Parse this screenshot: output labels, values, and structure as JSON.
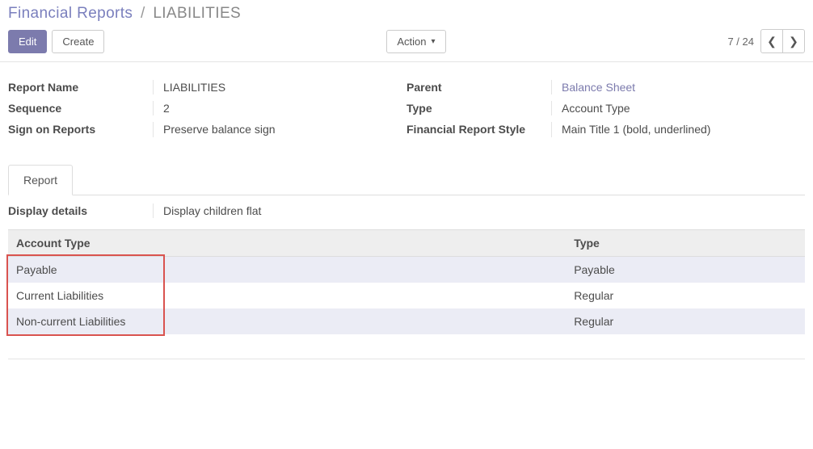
{
  "breadcrumb": {
    "root": "Financial Reports",
    "current": "LIABILITIES"
  },
  "toolbar": {
    "edit_label": "Edit",
    "create_label": "Create",
    "action_label": "Action"
  },
  "pager": {
    "position": "7 / 24"
  },
  "fields": {
    "report_name_label": "Report Name",
    "report_name_value": "LIABILITIES",
    "sequence_label": "Sequence",
    "sequence_value": "2",
    "sign_label": "Sign on Reports",
    "sign_value": "Preserve balance sign",
    "parent_label": "Parent",
    "parent_value": "Balance Sheet",
    "type_label": "Type",
    "type_value": "Account Type",
    "style_label": "Financial Report Style",
    "style_value": "Main Title 1 (bold, underlined)"
  },
  "tabs": {
    "report": "Report"
  },
  "details": {
    "display_label": "Display details",
    "display_value": "Display children flat"
  },
  "table": {
    "col_account_type": "Account Type",
    "col_type": "Type",
    "rows": [
      {
        "account_type": "Payable",
        "type": "Payable"
      },
      {
        "account_type": "Current Liabilities",
        "type": "Regular"
      },
      {
        "account_type": "Non-current Liabilities",
        "type": "Regular"
      }
    ]
  }
}
